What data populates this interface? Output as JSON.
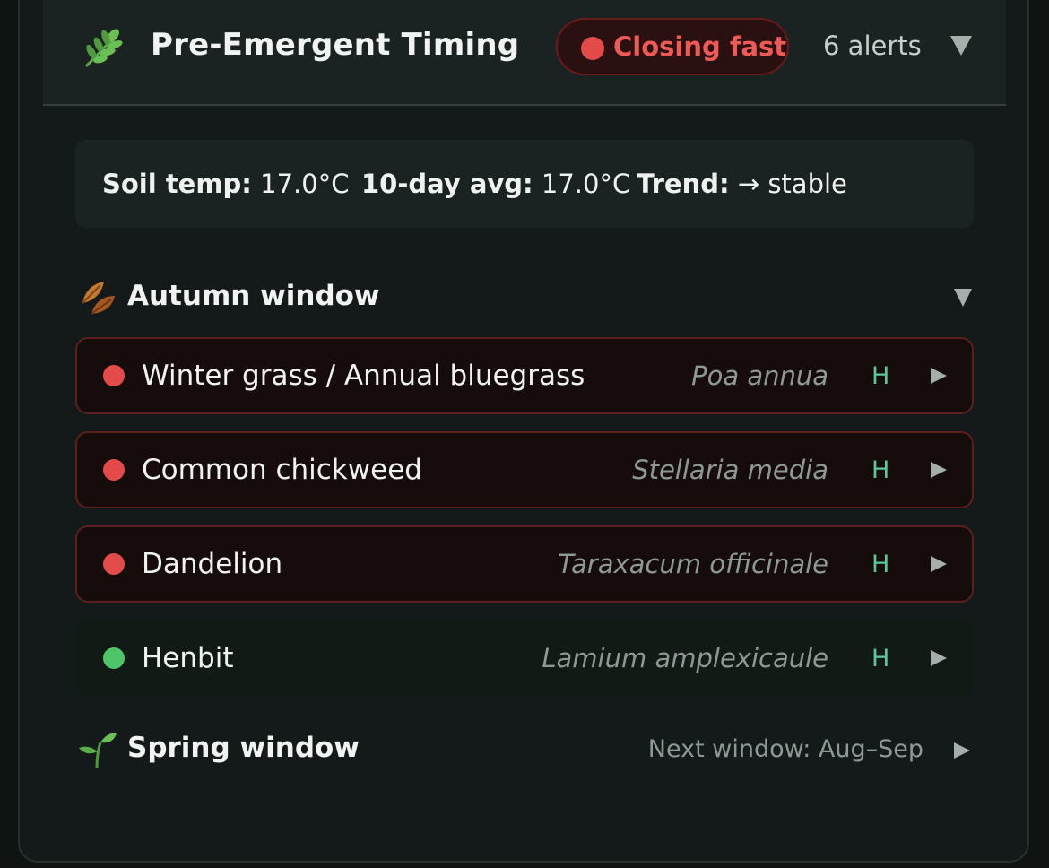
{
  "header": {
    "icon": "herb-leaf-icon",
    "title": "Pre-Emergent Timing",
    "status": {
      "label": "Closing fast",
      "color": "#e34b4b"
    },
    "alerts": "6 alerts"
  },
  "stats": {
    "soil_temp_label": "Soil temp:",
    "soil_temp_value": "17.0°C",
    "avg_label": "10-day avg:",
    "avg_value": "17.0°C",
    "trend_label": "Trend:",
    "trend_value": "→ stable"
  },
  "autumn": {
    "icon": "fallen-leaves-icon",
    "title": "Autumn window",
    "expanded": true,
    "weeds": [
      {
        "name": "Winter grass / Annual bluegrass",
        "scientific": "Poa annua",
        "tag": "H",
        "status": "red"
      },
      {
        "name": "Common chickweed",
        "scientific": "Stellaria media",
        "tag": "H",
        "status": "red"
      },
      {
        "name": "Dandelion",
        "scientific": "Taraxacum officinale",
        "tag": "H",
        "status": "red"
      },
      {
        "name": "Henbit",
        "scientific": "Lamium amplexicaule",
        "tag": "H",
        "status": "green"
      }
    ]
  },
  "spring": {
    "icon": "seedling-icon",
    "title": "Spring window",
    "next_window": "Next window: Aug–Sep",
    "expanded": false
  },
  "colors": {
    "accent_red": "#e34b4b",
    "accent_green": "#4fc468",
    "tag_teal": "#5ec79a"
  }
}
